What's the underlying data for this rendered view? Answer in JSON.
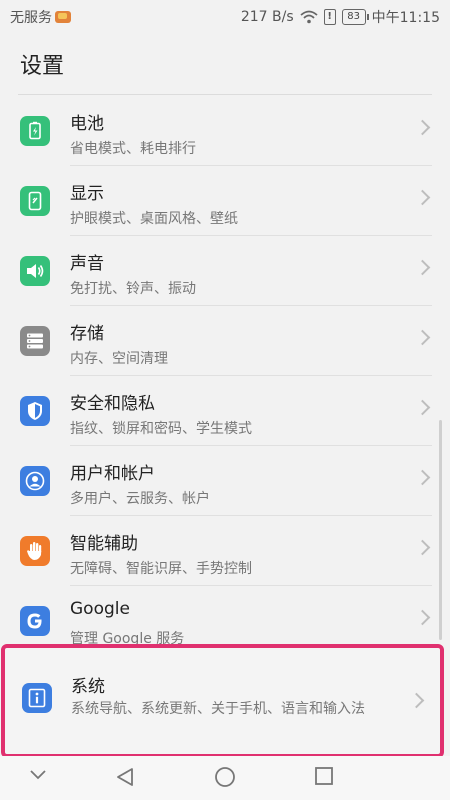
{
  "status_bar": {
    "carrier": "无服务",
    "speed": "217 B/s",
    "battery": "83",
    "alert_symbol": "!",
    "time": "中午11:15",
    "icons": [
      "app-notification-icon",
      "wifi-icon",
      "alert-icon",
      "battery-icon"
    ]
  },
  "header": {
    "title": "设置"
  },
  "items": [
    {
      "title": "电池",
      "subtitle": "省电模式、耗电排行",
      "icon": "battery-icon",
      "color": "#35c07a"
    },
    {
      "title": "显示",
      "subtitle": "护眼模式、桌面风格、壁纸",
      "icon": "display-icon",
      "color": "#35c07a"
    },
    {
      "title": "声音",
      "subtitle": "免打扰、铃声、振动",
      "icon": "sound-icon",
      "color": "#35c07a"
    },
    {
      "title": "存储",
      "subtitle": "内存、空间清理",
      "icon": "storage-icon",
      "color": "#8a8a8a"
    },
    {
      "title": "安全和隐私",
      "subtitle": "指纹、锁屏和密码、学生模式",
      "icon": "shield-icon",
      "color": "#3d7ee0"
    },
    {
      "title": "用户和帐户",
      "subtitle": "多用户、云服务、帐户",
      "icon": "user-icon",
      "color": "#3d7ee0"
    },
    {
      "title": "智能辅助",
      "subtitle": "无障碍、智能识屏、手势控制",
      "icon": "hand-icon",
      "color": "#f07b2b"
    },
    {
      "title": "Google",
      "subtitle": "管理 Google 服务",
      "icon": "google-icon",
      "color": "#3d7ee0"
    },
    {
      "title": "系统",
      "subtitle": "系统导航、系统更新、关于手机、语言和输入法",
      "icon": "info-icon",
      "color": "#3d7ee0"
    }
  ],
  "highlight_color": "#e0306f",
  "nav": {
    "icons": [
      "collapse-icon",
      "back-icon",
      "home-icon",
      "recents-icon"
    ]
  }
}
